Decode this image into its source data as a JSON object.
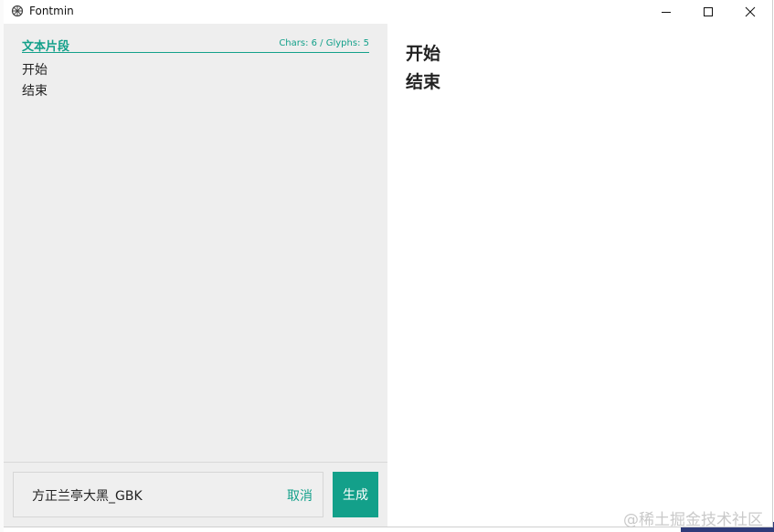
{
  "window": {
    "title": "Fontmin",
    "app_icon": "fontmin-logo-icon",
    "controls": [
      "minimize-icon",
      "maximize-icon",
      "close-icon"
    ]
  },
  "snippet": {
    "title": "文本片段",
    "stats": "Chars: 6 / Glyphs: 5",
    "text": "开始\n结束"
  },
  "preview": {
    "lines": [
      "开始",
      "结束"
    ]
  },
  "font_selector": {
    "value": "方正兰亭大黑_GBK",
    "cancel_label": "取消"
  },
  "generate_button": {
    "label": "生成"
  },
  "watermark": "@稀土掘金技术社区",
  "colors": {
    "accent": "#13a08a",
    "panel_bg": "#eeeeee"
  }
}
